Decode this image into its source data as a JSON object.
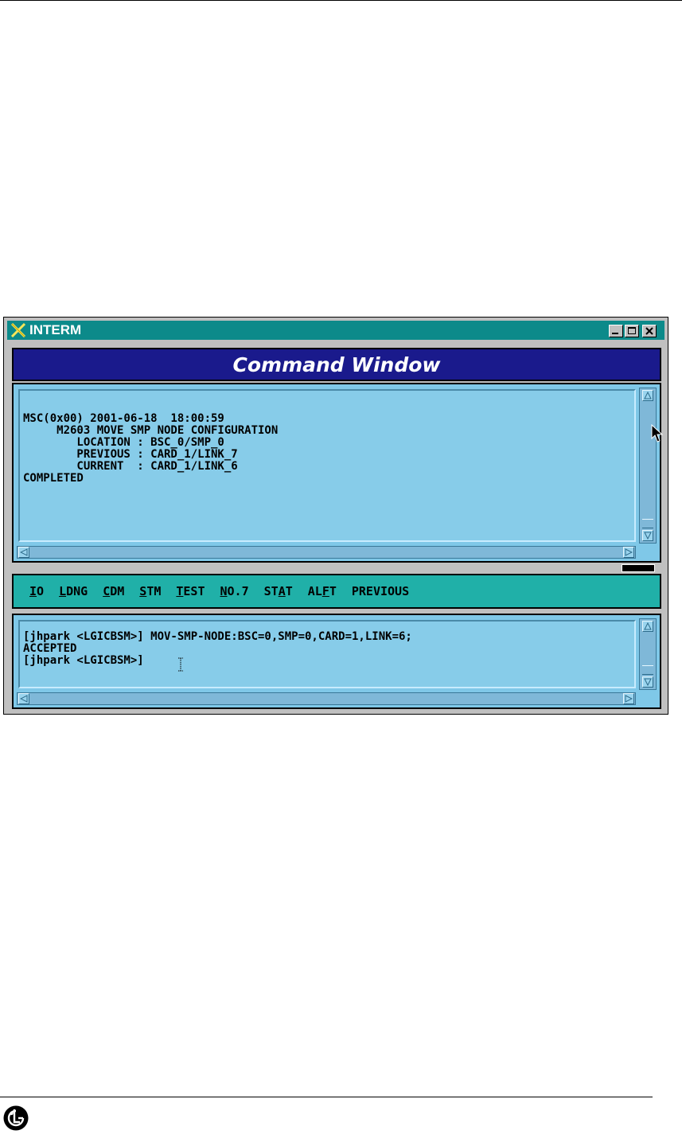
{
  "window": {
    "title": "INTERM",
    "header": "Command Window"
  },
  "output": {
    "lines": [
      "MSC(0x00) 2001-06-18  18:00:59",
      "     M2603 MOVE SMP NODE CONFIGURATION",
      "        LOCATION : BSC_0/SMP_0",
      "        PREVIOUS : CARD_1/LINK_7",
      "        CURRENT  : CARD_1/LINK_6",
      "COMPLETED"
    ]
  },
  "menu": {
    "items": [
      {
        "label": "IO",
        "underline": 0
      },
      {
        "label": "LDNG",
        "underline": 0
      },
      {
        "label": "CDM",
        "underline": 0
      },
      {
        "label": "STM",
        "underline": 0
      },
      {
        "label": "TEST",
        "underline": 0
      },
      {
        "label": "NO.7",
        "underline": 0
      },
      {
        "label": "STAT",
        "underline": 2
      },
      {
        "label": "ALFT",
        "underline": 2
      },
      {
        "label": "PREVIOUS",
        "underline": -1
      }
    ]
  },
  "input": {
    "lines": [
      "[jhpark <LGICBSM>] MOV-SMP-NODE:BSC=0,SMP=0,CARD=1,LINK=6;",
      "ACCEPTED",
      "[jhpark <LGICBSM>] "
    ]
  },
  "colors": {
    "titlebar": "#0c8a8a",
    "header": "#1a1a8c",
    "pane": "#87cce9",
    "menubar": "#20b0a8"
  },
  "icons": [
    "x-window-icon",
    "minimize-icon",
    "maximize-icon",
    "close-icon",
    "lg-logo-icon",
    "mouse-pointer-icon",
    "text-cursor-icon"
  ]
}
